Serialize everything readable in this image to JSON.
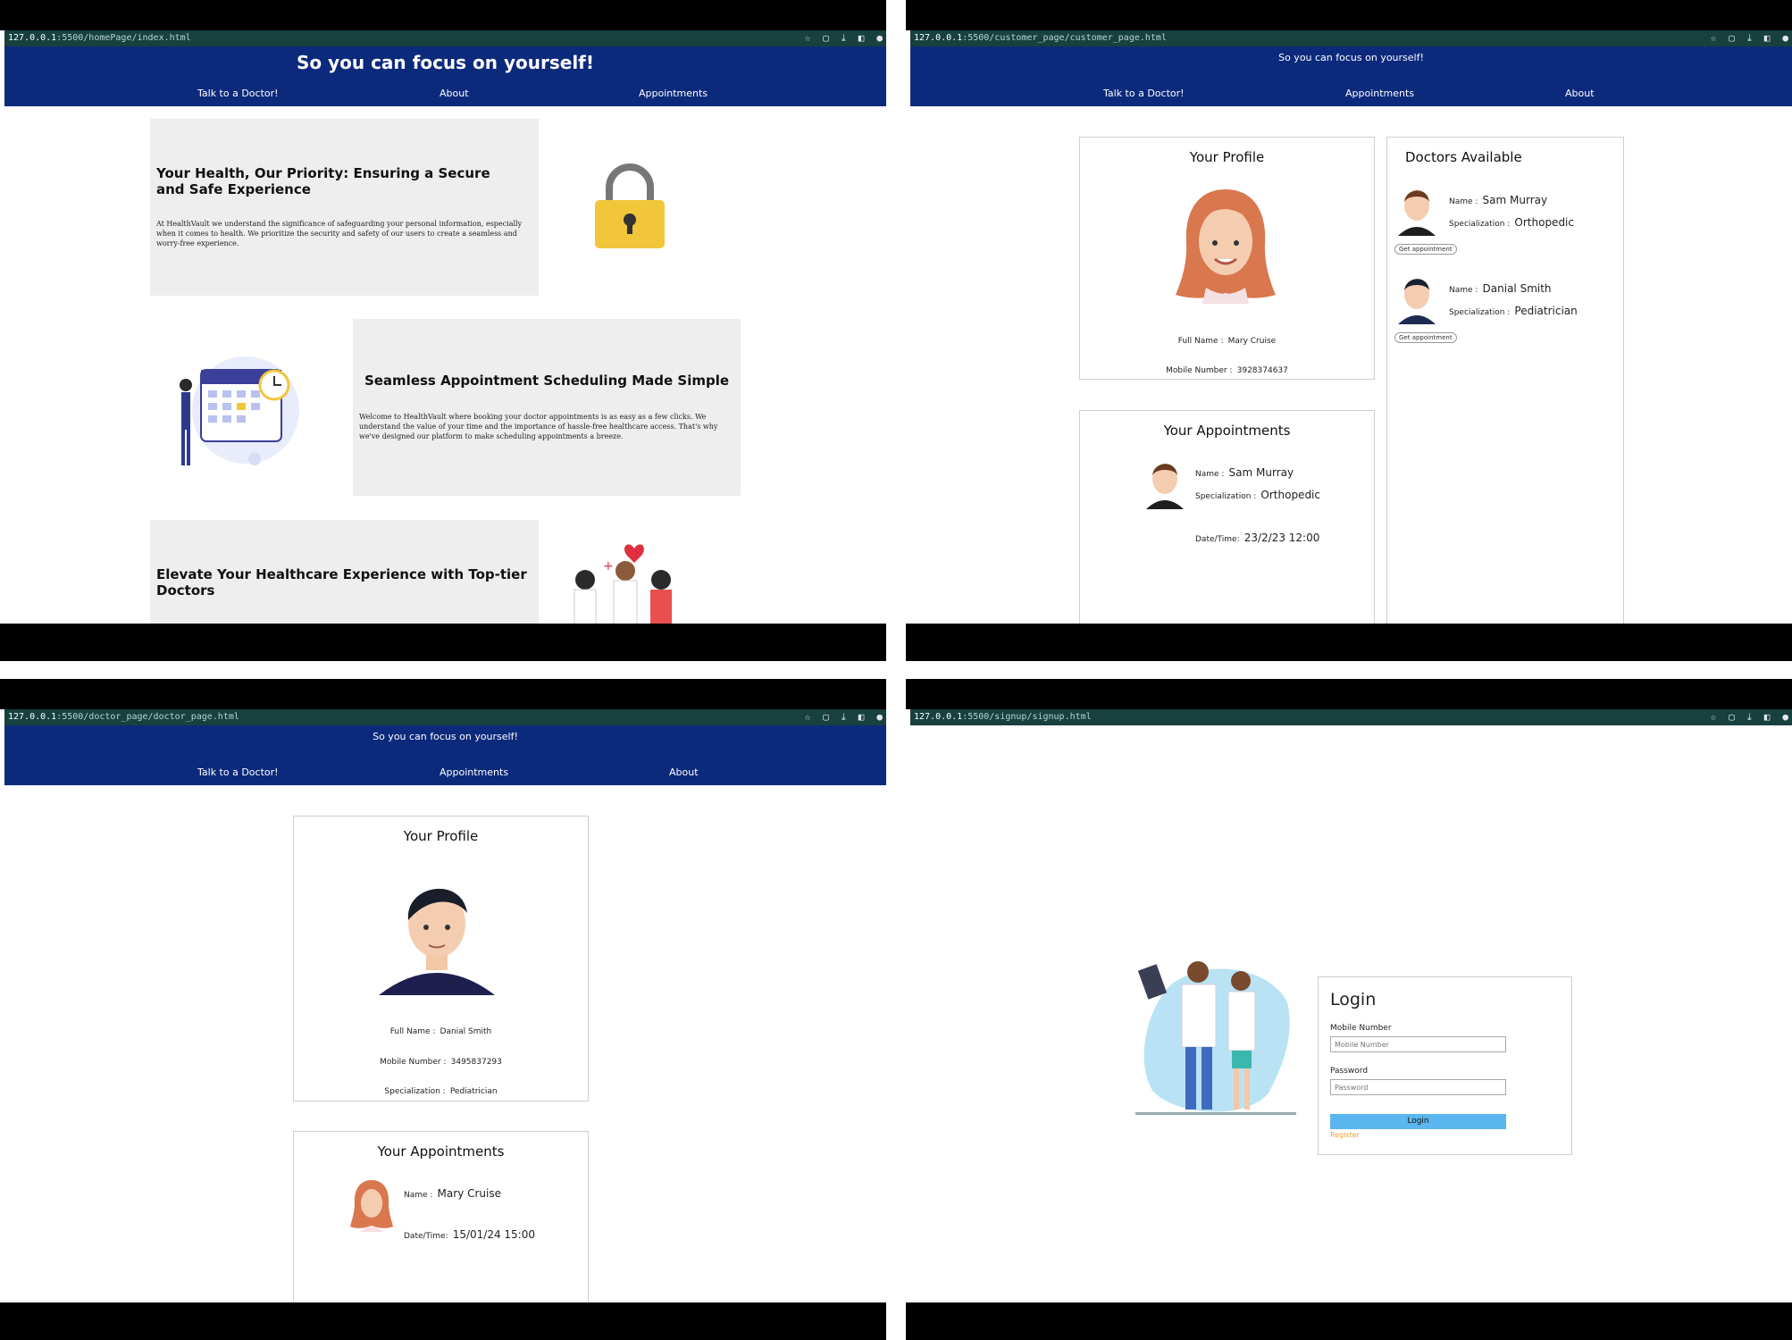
{
  "colors": {
    "nav_bg": "#0c2a7c",
    "addr_bg": "#17403f",
    "login_btn": "#5ab6ef",
    "register_link": "#e6a03b"
  },
  "panel1": {
    "url_host": "127.0.0.1",
    "url_path": ":5500/homePage/index.html",
    "tagline": "So you can focus on yourself!",
    "nav": [
      "Talk to a Doctor!",
      "About",
      "Appointments"
    ],
    "sections": [
      {
        "title": "Your Health, Our Priority: Ensuring a Secure and Safe Experience",
        "text": "At HealthVault we understand the significance of safeguarding your personal information, especially when it comes to health. We prioritize the security and safety of our users to create a seamless and worry-free experience."
      },
      {
        "title": "Seamless Appointment Scheduling Made Simple",
        "text": "Welcome to HealthVault where booking your doctor appointments is as easy as a few clicks. We understand the value of your time and the importance of hassle-free healthcare access. That's why we've designed our platform to make scheduling appointments a breeze."
      },
      {
        "title": "Elevate Your Healthcare Experience with Top-tier Doctors"
      }
    ]
  },
  "panel2": {
    "url_host": "127.0.0.1",
    "url_path": ":5500/customer_page/customer_page.html",
    "tagline": "So you can focus on yourself!",
    "nav": [
      "Talk to a Doctor!",
      "Appointments",
      "About"
    ],
    "profile": {
      "title": "Your Profile",
      "full_name_label": "Full Name :",
      "full_name": "Mary Cruise",
      "mobile_label": "Mobile Number :",
      "mobile": "3928374637"
    },
    "appointments": {
      "title": "Your Appointments",
      "name_label": "Name :",
      "name": "Sam Murray",
      "spec_label": "Specialization :",
      "spec": "Orthopedic",
      "date_label": "Date/Time:",
      "date": "23/2/23 12:00"
    },
    "doctors": {
      "title": "Doctors Available",
      "button": "Get appointment",
      "items": [
        {
          "name_label": "Name :",
          "name": "Sam Murray",
          "spec_label": "Specialization :",
          "spec": "Orthopedic"
        },
        {
          "name_label": "Name :",
          "name": "Danial Smith",
          "spec_label": "Specialization :",
          "spec": "Pediatrician"
        }
      ]
    }
  },
  "panel3": {
    "url_host": "127.0.0.1",
    "url_path": ":5500/doctor_page/doctor_page.html",
    "tagline": "So you can focus on yourself!",
    "nav": [
      "Talk to a Doctor!",
      "Appointments",
      "About"
    ],
    "profile": {
      "title": "Your Profile",
      "full_name_label": "Full Name :",
      "full_name": "Danial Smith",
      "mobile_label": "Mobile Number :",
      "mobile": "3495837293",
      "spec_label": "Specialization :",
      "spec": "Pediatrician"
    },
    "appointments": {
      "title": "Your Appointments",
      "name_label": "Name :",
      "name": "Mary Cruise",
      "date_label": "Date/Time:",
      "date": "15/01/24 15:00"
    }
  },
  "panel4": {
    "url_host": "127.0.0.1",
    "url_path": ":5500/signup/signup.html",
    "login": {
      "title": "Login",
      "mobile_label": "Mobile Number",
      "mobile_placeholder": "Mobile Number",
      "password_label": "Password",
      "password_placeholder": "Password",
      "button": "Login",
      "register": "Register"
    }
  }
}
